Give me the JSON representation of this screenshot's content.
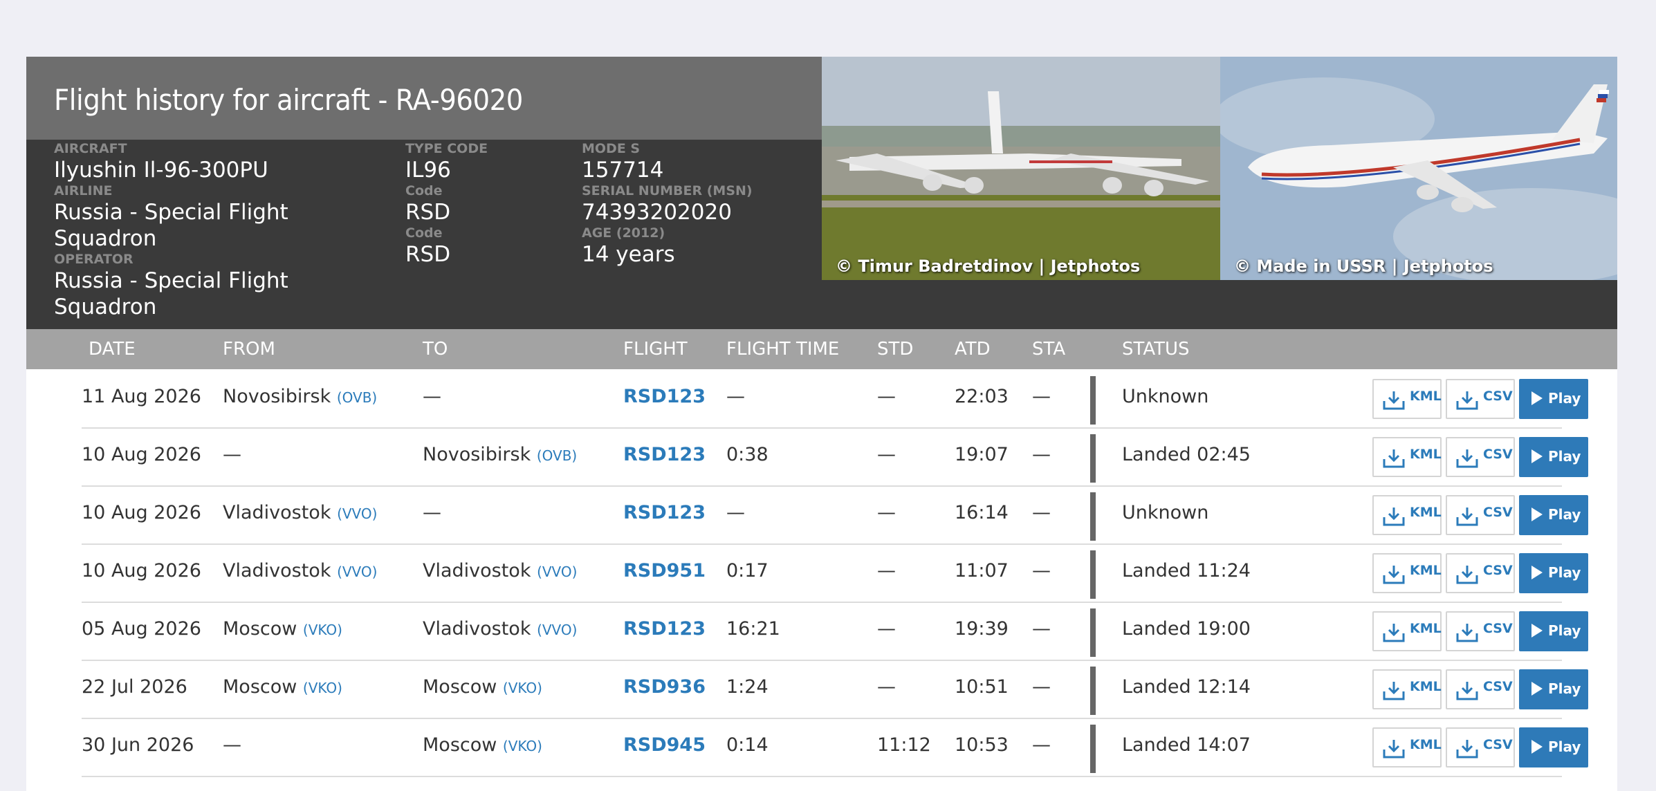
{
  "title": "Flight history for aircraft - RA-96020",
  "details": {
    "aircraft_label": "AIRCRAFT",
    "aircraft": "Ilyushin Il-96-300PU",
    "airline_label": "AIRLINE",
    "airline_line1": "Russia - Special Flight",
    "airline_line2": "Squadron",
    "operator_label": "OPERATOR",
    "operator_line1": "Russia - Special Flight",
    "operator_line2": "Squadron",
    "type_code_label": "TYPE CODE",
    "type_code": "IL96",
    "code_label_1": "Code",
    "code_1": "RSD",
    "code_label_2": "Code",
    "code_2": "RSD",
    "mode_s_label": "MODE S",
    "mode_s": "157714",
    "serial_label": "SERIAL NUMBER (MSN)",
    "serial": "74393202020",
    "age_label": "AGE (2012)",
    "age": "14 years"
  },
  "photos": [
    {
      "credit": "© Timur Badretdinov | Jetphotos"
    },
    {
      "credit": "© Made in USSR | Jetphotos"
    }
  ],
  "columns": [
    "DATE",
    "FROM",
    "TO",
    "FLIGHT",
    "FLIGHT TIME",
    "STD",
    "ATD",
    "STA",
    "STATUS"
  ],
  "buttons": {
    "kml": "KML",
    "csv": "CSV",
    "play": "Play"
  },
  "rows": [
    {
      "date": "11 Aug 2026",
      "from": "Novosibirsk",
      "from_code": "(OVB)",
      "to": "—",
      "to_code": "",
      "flight": "RSD123",
      "flight_time": "—",
      "std": "—",
      "atd": "22:03",
      "sta": "—",
      "status": "Unknown"
    },
    {
      "date": "10 Aug 2026",
      "from": "—",
      "from_code": "",
      "to": "Novosibirsk",
      "to_code": "(OVB)",
      "flight": "RSD123",
      "flight_time": "0:38",
      "std": "—",
      "atd": "19:07",
      "sta": "—",
      "status": "Landed 02:45"
    },
    {
      "date": "10 Aug 2026",
      "from": "Vladivostok",
      "from_code": "(VVO)",
      "to": "—",
      "to_code": "",
      "flight": "RSD123",
      "flight_time": "—",
      "std": "—",
      "atd": "16:14",
      "sta": "—",
      "status": "Unknown"
    },
    {
      "date": "10 Aug 2026",
      "from": "Vladivostok",
      "from_code": "(VVO)",
      "to": "Vladivostok",
      "to_code": "(VVO)",
      "flight": "RSD951",
      "flight_time": "0:17",
      "std": "—",
      "atd": "11:07",
      "sta": "—",
      "status": "Landed 11:24"
    },
    {
      "date": "05 Aug 2026",
      "from": "Moscow",
      "from_code": "(VKO)",
      "to": "Vladivostok",
      "to_code": "(VVO)",
      "flight": "RSD123",
      "flight_time": "16:21",
      "std": "—",
      "atd": "19:39",
      "sta": "—",
      "status": "Landed 19:00"
    },
    {
      "date": "22 Jul 2026",
      "from": "Moscow",
      "from_code": "(VKO)",
      "to": "Moscow",
      "to_code": "(VKO)",
      "flight": "RSD936",
      "flight_time": "1:24",
      "std": "—",
      "atd": "10:51",
      "sta": "—",
      "status": "Landed 12:14"
    },
    {
      "date": "30 Jun 2026",
      "from": "—",
      "from_code": "",
      "to": "Moscow",
      "to_code": "(VKO)",
      "flight": "RSD945",
      "flight_time": "0:14",
      "std": "11:12",
      "atd": "10:53",
      "sta": "—",
      "status": "Landed 14:07"
    }
  ],
  "colors": {
    "accent": "#2e7ab8",
    "header_dark": "#3a3a3a",
    "header_title_band": "#6e6e6e",
    "column_header": "#a3a3a3"
  }
}
